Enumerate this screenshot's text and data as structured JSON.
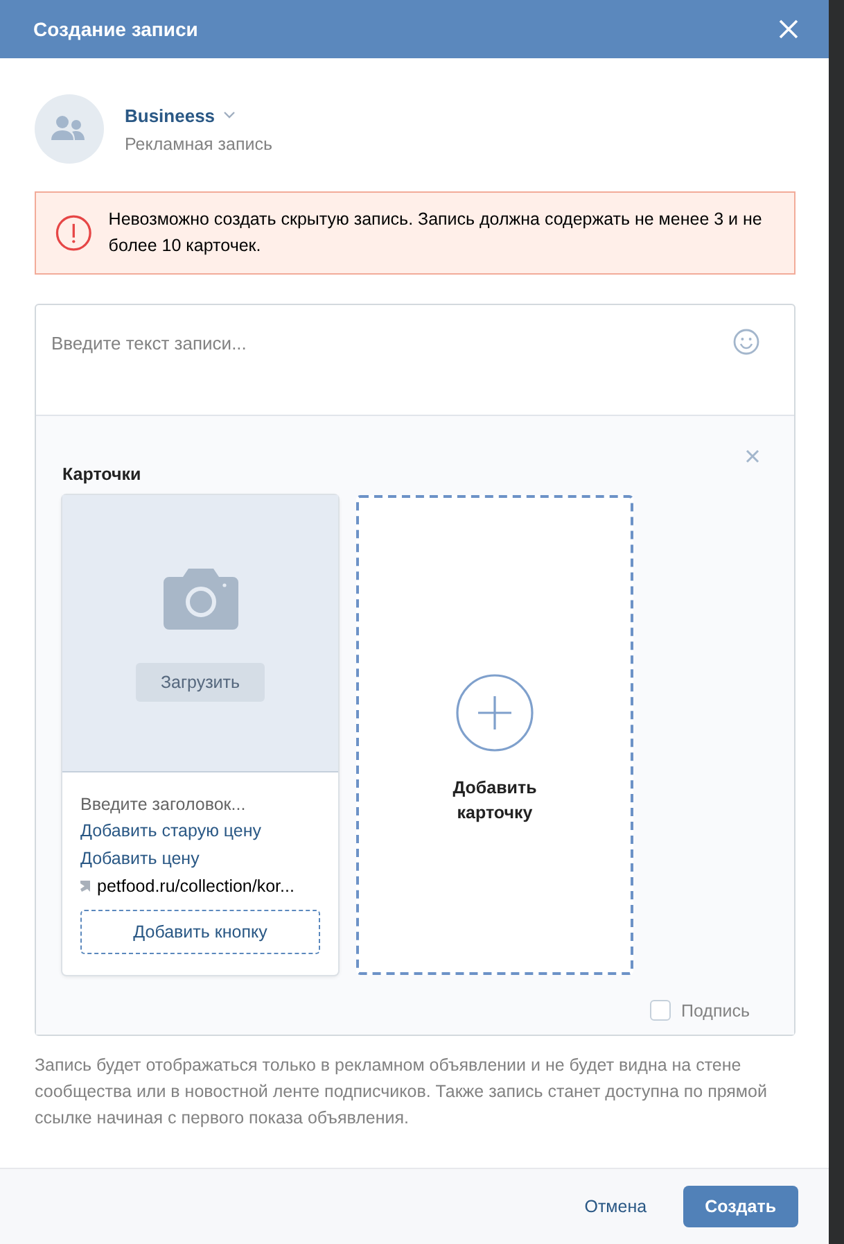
{
  "modal": {
    "title": "Создание записи"
  },
  "author": {
    "name": "Busineess",
    "subtitle": "Рекламная запись"
  },
  "alert": {
    "text": "Невозможно создать скрытую запись. Запись должна содержать не менее 3 и не более 10 карточек."
  },
  "editor": {
    "placeholder": "Введите текст записи..."
  },
  "cards_section": {
    "title": "Карточки",
    "cards": [
      {
        "kind": "card",
        "upload_button": "Загрузить",
        "title_placeholder": "Введите заголовок...",
        "links": [
          "Добавить старую цену",
          "Добавить цену"
        ],
        "url": "petfood.ru/collection/kor...",
        "add_button": "Добавить кнопку"
      },
      {
        "kind": "add",
        "label": "Добавить карточку"
      }
    ],
    "signature": {
      "label": "Подпись",
      "checked": false
    }
  },
  "note": "Запись будет отображаться только в рекламном объявлении и не будет видна на стене сообщества или в новостной ленте подписчиков. Также запись станет доступна по прямой ссылке начиная с первого показа объявления.",
  "buttons": {
    "cancel": "Отмена",
    "submit": "Создать"
  }
}
